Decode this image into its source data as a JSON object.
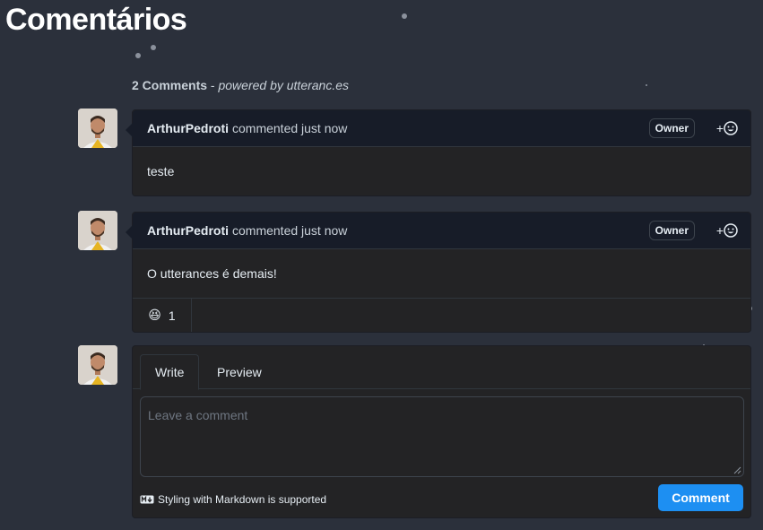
{
  "page": {
    "title": "Comentários"
  },
  "summary": {
    "count": "2 Comments",
    "separator": " - ",
    "powered_by": "powered by utteranc.es"
  },
  "comments": [
    {
      "author": "ArthurPedroti",
      "action": "commented just now",
      "badge": "Owner",
      "react_plus": "+",
      "body": "teste"
    },
    {
      "author": "ArthurPedroti",
      "action": "commented just now",
      "badge": "Owner",
      "react_plus": "+",
      "body": "O utterances é demais!",
      "reactions": [
        {
          "emoji": "😆",
          "count": "1"
        }
      ]
    }
  ],
  "editor": {
    "tabs": [
      {
        "label": "Write"
      },
      {
        "label": "Preview"
      }
    ],
    "placeholder": "Leave a comment",
    "markdown_note": "Styling with Markdown is supported",
    "submit_label": "Comment"
  },
  "colors": {
    "accent": "#1d8ff2",
    "background": "#2b303b",
    "header": "#171c28"
  }
}
